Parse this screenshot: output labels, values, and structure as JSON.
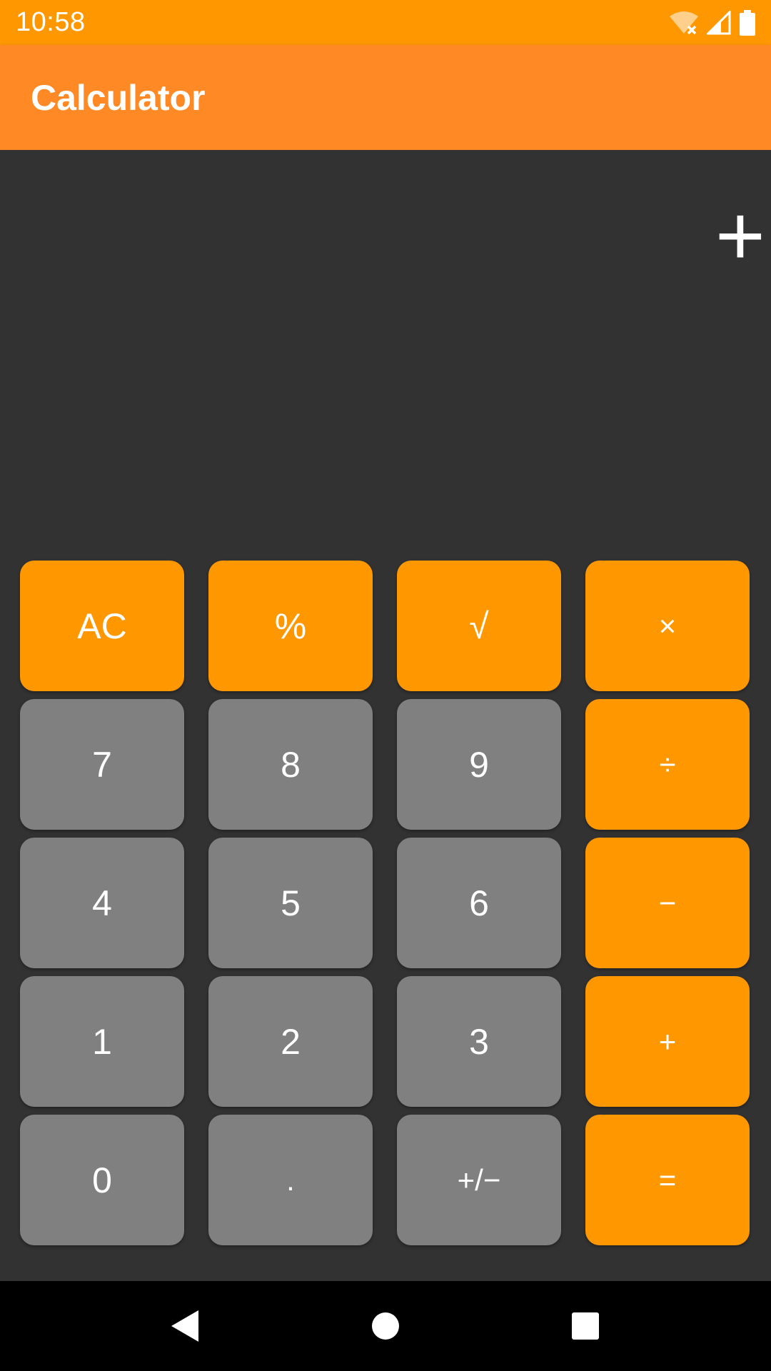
{
  "status_bar": {
    "time": "10:58",
    "icons": [
      "wifi-off-icon",
      "signal-icon",
      "battery-icon"
    ]
  },
  "app_bar": {
    "title": "Calculator"
  },
  "display": {
    "text": "+"
  },
  "keypad": {
    "rows": [
      [
        {
          "label": "AC",
          "kind": "op"
        },
        {
          "label": "%",
          "kind": "op"
        },
        {
          "label": "√",
          "kind": "op"
        },
        {
          "label": "×",
          "kind": "op"
        }
      ],
      [
        {
          "label": "7",
          "kind": "num"
        },
        {
          "label": "8",
          "kind": "num"
        },
        {
          "label": "9",
          "kind": "num"
        },
        {
          "label": "÷",
          "kind": "op"
        }
      ],
      [
        {
          "label": "4",
          "kind": "num"
        },
        {
          "label": "5",
          "kind": "num"
        },
        {
          "label": "6",
          "kind": "num"
        },
        {
          "label": "−",
          "kind": "op"
        }
      ],
      [
        {
          "label": "1",
          "kind": "num"
        },
        {
          "label": "2",
          "kind": "num"
        },
        {
          "label": "3",
          "kind": "num"
        },
        {
          "label": "+",
          "kind": "op"
        }
      ],
      [
        {
          "label": "0",
          "kind": "num"
        },
        {
          "label": ".",
          "kind": "num"
        },
        {
          "label": "+/−",
          "kind": "num"
        },
        {
          "label": "=",
          "kind": "op"
        }
      ]
    ]
  },
  "nav_bar": {
    "buttons": [
      "back-icon",
      "home-icon",
      "recents-icon"
    ]
  },
  "colors": {
    "status_bar": "#FF9800",
    "app_bar": "#FF8A25",
    "background": "#323232",
    "operator_key": "#FF9800",
    "number_key": "#808080"
  }
}
